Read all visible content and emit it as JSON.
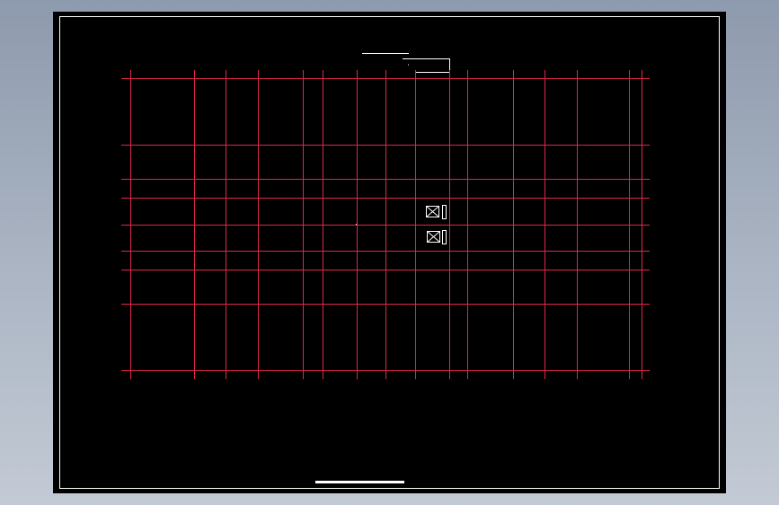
{
  "colors": {
    "background_outer": "#a0abbb",
    "sheet": "#000000",
    "frame": "#ffffff",
    "grid": "#e0284a",
    "symbols": "#ffffff"
  },
  "drawing": {
    "type": "cad-grid-plan",
    "vertical_grid_lines": 16,
    "horizontal_grid_lines": 9,
    "symbols": [
      {
        "name": "window-box-icon",
        "label": ""
      },
      {
        "name": "window-box-icon",
        "label": ""
      }
    ]
  }
}
